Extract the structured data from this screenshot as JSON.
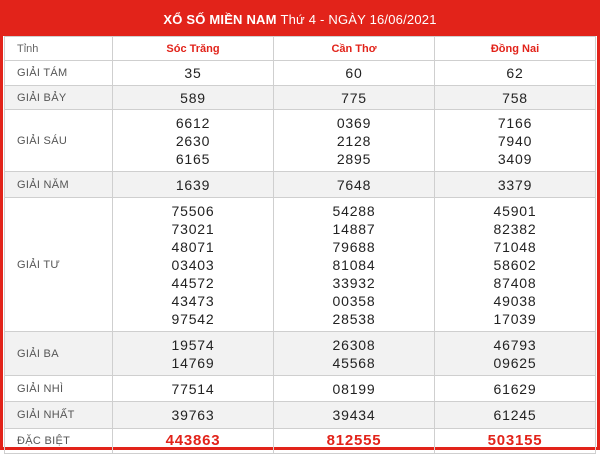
{
  "title": {
    "main": "XỔ SỐ MIỀN NAM",
    "sub": "Thứ 4 - NGÀY 16/06/2021"
  },
  "header": {
    "label": "Tỉnh",
    "provinces": [
      "Sóc Trăng",
      "Cần Thơ",
      "Đồng Nai"
    ]
  },
  "prizes": [
    {
      "label": "GIẢI TÁM",
      "values": [
        [
          "35"
        ],
        [
          "60"
        ],
        [
          "62"
        ]
      ]
    },
    {
      "label": "GIẢI BẢY",
      "values": [
        [
          "589"
        ],
        [
          "775"
        ],
        [
          "758"
        ]
      ]
    },
    {
      "label": "GIẢI SÁU",
      "values": [
        [
          "6612",
          "2630",
          "6165"
        ],
        [
          "0369",
          "2128",
          "2895"
        ],
        [
          "7166",
          "7940",
          "3409"
        ]
      ]
    },
    {
      "label": "GIẢI NĂM",
      "values": [
        [
          "1639"
        ],
        [
          "7648"
        ],
        [
          "3379"
        ]
      ]
    },
    {
      "label": "GIẢI TƯ",
      "values": [
        [
          "75506",
          "73021",
          "48071",
          "03403",
          "44572",
          "43473",
          "97542"
        ],
        [
          "54288",
          "14887",
          "79688",
          "81084",
          "33932",
          "00358",
          "28538"
        ],
        [
          "45901",
          "82382",
          "71048",
          "58602",
          "87408",
          "49038",
          "17039"
        ]
      ]
    },
    {
      "label": "GIẢI BA",
      "values": [
        [
          "19574",
          "14769"
        ],
        [
          "26308",
          "45568"
        ],
        [
          "46793",
          "09625"
        ]
      ]
    },
    {
      "label": "GIẢI NHÌ",
      "values": [
        [
          "77514"
        ],
        [
          "08199"
        ],
        [
          "61629"
        ]
      ]
    },
    {
      "label": "GIẢI NHẤT",
      "values": [
        [
          "39763"
        ],
        [
          "39434"
        ],
        [
          "61245"
        ]
      ]
    },
    {
      "label": "ĐẶC BIỆT",
      "values": [
        [
          "443863"
        ],
        [
          "812555"
        ],
        [
          "503155"
        ]
      ]
    }
  ],
  "colors": {
    "accent": "#e2231a",
    "alt_row": "#f2f2f2"
  }
}
